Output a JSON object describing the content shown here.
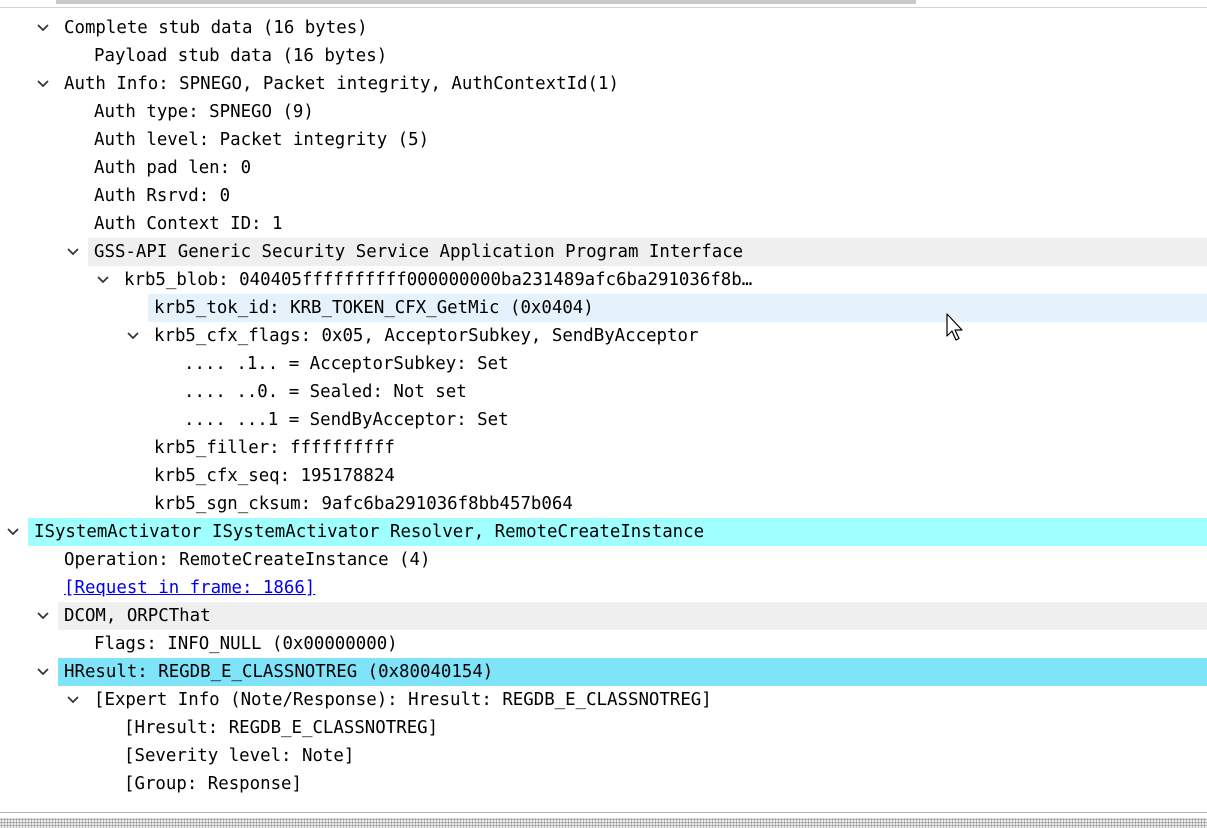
{
  "tree": [
    {
      "key": "r0",
      "depth": 1,
      "expander": true,
      "text": "Complete stub data (16 bytes)"
    },
    {
      "key": "r1",
      "depth": 2,
      "expander": false,
      "text": "Payload stub data (16 bytes)"
    },
    {
      "key": "r2",
      "depth": 1,
      "expander": true,
      "text": "Auth Info: SPNEGO, Packet integrity, AuthContextId(1)"
    },
    {
      "key": "r3",
      "depth": 2,
      "expander": false,
      "text": "Auth type: SPNEGO (9)"
    },
    {
      "key": "r4",
      "depth": 2,
      "expander": false,
      "text": "Auth level: Packet integrity (5)"
    },
    {
      "key": "r5",
      "depth": 2,
      "expander": false,
      "text": "Auth pad len: 0"
    },
    {
      "key": "r6",
      "depth": 2,
      "expander": false,
      "text": "Auth Rsrvd: 0"
    },
    {
      "key": "r7",
      "depth": 2,
      "expander": false,
      "text": "Auth Context ID: 1"
    },
    {
      "key": "r8",
      "depth": 2,
      "expander": true,
      "highlight": "gray",
      "text": "GSS-API Generic Security Service Application Program Interface"
    },
    {
      "key": "r9",
      "depth": 3,
      "expander": true,
      "text": "krb5_blob: 040405ffffffffff000000000ba231489afc6ba291036f8b…"
    },
    {
      "key": "r10",
      "depth": 4,
      "expander": false,
      "highlight": "sel",
      "text": "krb5_tok_id: KRB_TOKEN_CFX_GetMic (0x0404)"
    },
    {
      "key": "r11",
      "depth": 4,
      "expander": true,
      "text": "krb5_cfx_flags: 0x05, AcceptorSubkey, SendByAcceptor"
    },
    {
      "key": "r12",
      "depth": 5,
      "expander": false,
      "text": ".... .1.. = AcceptorSubkey: Set"
    },
    {
      "key": "r13",
      "depth": 5,
      "expander": false,
      "text": ".... ..0. = Sealed: Not set"
    },
    {
      "key": "r14",
      "depth": 5,
      "expander": false,
      "text": ".... ...1 = SendByAcceptor: Set"
    },
    {
      "key": "r15",
      "depth": 4,
      "expander": false,
      "text": "krb5_filler: ffffffffff"
    },
    {
      "key": "r16",
      "depth": 4,
      "expander": false,
      "text": "krb5_cfx_seq: 195178824"
    },
    {
      "key": "r17",
      "depth": 4,
      "expander": false,
      "text": "krb5_sgn_cksum: 9afc6ba291036f8bb457b064"
    },
    {
      "key": "r18",
      "depth": 0,
      "expander": true,
      "highlight": "cyan",
      "text": "ISystemActivator ISystemActivator Resolver, RemoteCreateInstance"
    },
    {
      "key": "r19",
      "depth": 1,
      "expander": false,
      "text": "Operation: RemoteCreateInstance (4)"
    },
    {
      "key": "r20",
      "depth": 1,
      "expander": false,
      "link": true,
      "text": "[Request in frame: 1866]"
    },
    {
      "key": "r21",
      "depth": 1,
      "expander": true,
      "highlight": "gray",
      "text": "DCOM, ORPCThat"
    },
    {
      "key": "r22",
      "depth": 2,
      "expander": false,
      "text": "Flags: INFO_NULL (0x00000000)"
    },
    {
      "key": "r23",
      "depth": 1,
      "expander": true,
      "highlight": "blue",
      "text": "HResult: REGDB_E_CLASSNOTREG (0x80040154)"
    },
    {
      "key": "r24",
      "depth": 2,
      "expander": true,
      "text": "[Expert Info (Note/Response): Hresult: REGDB_E_CLASSNOTREG]"
    },
    {
      "key": "r25",
      "depth": 3,
      "expander": false,
      "text": "[Hresult: REGDB_E_CLASSNOTREG]"
    },
    {
      "key": "r26",
      "depth": 3,
      "expander": false,
      "text": "[Severity level: Note]"
    },
    {
      "key": "r27",
      "depth": 3,
      "expander": false,
      "text": "[Group: Response]"
    }
  ],
  "icons": {
    "expander": "chevron-down-icon",
    "cursor": "mouse-pointer-icon"
  },
  "colors": {
    "selected_row": "#e5f1fb",
    "field_gray": "#efefef",
    "layer_cyan": "#a0ffff",
    "hresult_blue": "#7fe3f9",
    "link": "#0000ee"
  }
}
